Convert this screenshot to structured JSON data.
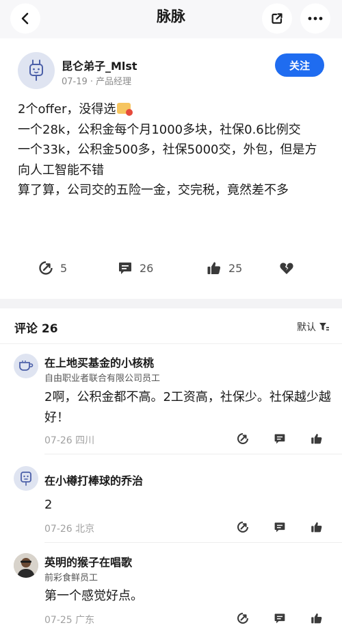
{
  "header": {
    "title": "脉脉",
    "back_icon": "chevron-left-icon",
    "share_icon": "share-out-icon",
    "more_icon": "more-dots-icon"
  },
  "author": {
    "name": "昆仑弟子_Mlst",
    "meta": "07-19 · 产品经理",
    "follow_label": "关注"
  },
  "post": {
    "lines": [
      "2个offer，没得选",
      "一个28k，公积金每个月1000多块，社保0.6比例交",
      "一个33k，公积金500多，社保5000交，外包，但是方向人工智能不错",
      "算了算，公司交的五险一金，交完税，竟然差不多"
    ]
  },
  "actions": {
    "share_count": "5",
    "comment_count": "26",
    "like_count": "25"
  },
  "comments_section": {
    "title": "评论 26",
    "sort_label": "默认"
  },
  "comments": [
    {
      "name": "在上地买基金的小核桃",
      "subtitle": "自由职业者联合有限公司员工",
      "text": "2啊，公积金都不高。2工资高，社保少。社保越少越好！",
      "meta": "07-26 四川"
    },
    {
      "name": "在小樽打棒球的乔治",
      "subtitle": "",
      "text": "2",
      "meta": "07-26 北京"
    },
    {
      "name": "英明的猴子在唱歌",
      "subtitle": "前彩食鲜员工",
      "text": "第一个感觉好点。",
      "meta": "07-25 广东"
    }
  ],
  "colors": {
    "accent": "#1f6cf0",
    "icon": "#3a3a3a",
    "muted": "#a0a0a0"
  }
}
